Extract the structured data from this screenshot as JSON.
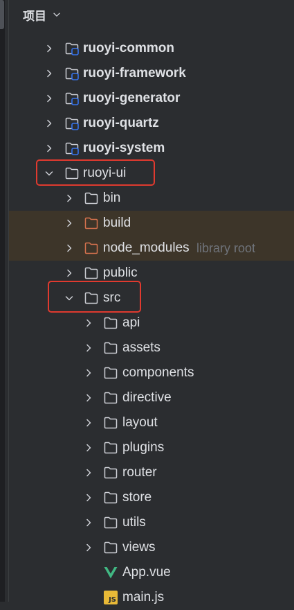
{
  "header": {
    "title": "项目",
    "toggle_icon": "chevron-down-icon"
  },
  "tree": {
    "ruoyi_common": {
      "label": "ruoyi-common",
      "icon": "module-folder-icon"
    },
    "ruoyi_framework": {
      "label": "ruoyi-framework",
      "icon": "module-folder-icon"
    },
    "ruoyi_generator": {
      "label": "ruoyi-generator",
      "icon": "module-folder-icon"
    },
    "ruoyi_quartz": {
      "label": "ruoyi-quartz",
      "icon": "module-folder-icon"
    },
    "ruoyi_system": {
      "label": "ruoyi-system",
      "icon": "module-folder-icon"
    },
    "ruoyi_ui": {
      "label": "ruoyi-ui",
      "icon": "folder-icon",
      "expanded": true
    },
    "bin": {
      "label": "bin",
      "icon": "folder-icon"
    },
    "build": {
      "label": "build",
      "icon": "excluded-folder-icon"
    },
    "node_modules": {
      "label": "node_modules",
      "hint": "library root",
      "icon": "excluded-folder-icon"
    },
    "public": {
      "label": "public",
      "icon": "folder-icon"
    },
    "src": {
      "label": "src",
      "icon": "folder-icon",
      "expanded": true
    },
    "api": {
      "label": "api",
      "icon": "folder-icon"
    },
    "assets": {
      "label": "assets",
      "icon": "folder-icon"
    },
    "components": {
      "label": "components",
      "icon": "folder-icon"
    },
    "directive": {
      "label": "directive",
      "icon": "folder-icon"
    },
    "layout": {
      "label": "layout",
      "icon": "folder-icon"
    },
    "plugins": {
      "label": "plugins",
      "icon": "folder-icon"
    },
    "router": {
      "label": "router",
      "icon": "folder-icon"
    },
    "store": {
      "label": "store",
      "icon": "folder-icon"
    },
    "utils": {
      "label": "utils",
      "icon": "folder-icon"
    },
    "views": {
      "label": "views",
      "icon": "folder-icon"
    },
    "app_vue": {
      "label": "App.vue",
      "icon": "vue-file-icon"
    },
    "main_js": {
      "label": "main.js",
      "icon": "js-file-icon",
      "badge": "JS"
    }
  },
  "colors": {
    "background": "#2b2d30",
    "text": "#dfe1e5",
    "muted_text": "#6f737a",
    "excluded_folder": "#d9744f",
    "excluded_row": "#3d3529",
    "module_badge": "#3574f0",
    "highlight_box": "#e03a2f",
    "vue_green": "#41b883",
    "js_yellow": "#e8b937"
  }
}
